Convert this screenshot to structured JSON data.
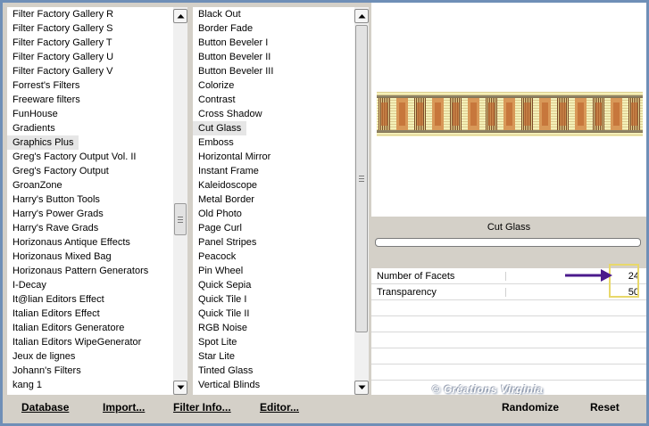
{
  "categories": {
    "items": [
      "Filter Factory Gallery R",
      "Filter Factory Gallery S",
      "Filter Factory Gallery T",
      "Filter Factory Gallery U",
      "Filter Factory Gallery V",
      "Forrest's Filters",
      "Freeware filters",
      "FunHouse",
      "Gradients",
      "Graphics Plus",
      "Greg's Factory Output Vol. II",
      "Greg's Factory Output",
      "GroanZone",
      "Harry's Button Tools",
      "Harry's Power Grads",
      "Harry's Rave Grads",
      "Horizonaus Antique Effects",
      "Horizonaus Mixed Bag",
      "Horizonaus Pattern Generators",
      "I-Decay",
      "It@lian Editors Effect",
      "Italian Editors Effect",
      "Italian Editors Generatore",
      "Italian Editors WipeGenerator",
      "Jeux de lignes",
      "Johann's Filters",
      "kang 1"
    ],
    "selected_index": 9
  },
  "filters": {
    "items": [
      "Black Out",
      "Border Fade",
      "Button Beveler I",
      "Button Beveler II",
      "Button Beveler III",
      "Colorize",
      "Contrast",
      "Cross Shadow",
      "Cut Glass",
      "Emboss",
      "Horizontal Mirror",
      "Instant Frame",
      "Kaleidoscope",
      "Metal Border",
      "Old Photo",
      "Page Curl",
      "Panel Stripes",
      "Peacock",
      "Pin Wheel",
      "Quick Sepia",
      "Quick Tile I",
      "Quick Tile II",
      "RGB Noise",
      "Spot Lite",
      "Star Lite",
      "Tinted Glass",
      "Vertical Blinds"
    ],
    "selected_index": 8
  },
  "filter_panel": {
    "title": "Cut Glass",
    "params": [
      {
        "name": "Number of Facets",
        "value": "24"
      },
      {
        "name": "Transparency",
        "value": "50"
      }
    ]
  },
  "buttons": {
    "database": "Database",
    "import": "Import...",
    "filter_info": "Filter Info...",
    "editor": "Editor...",
    "randomize": "Randomize",
    "reset": "Reset"
  },
  "watermark": "© Créations Virginia",
  "colors": {
    "window_border": "#6f8fb7",
    "panel_gray": "#d4d0c8",
    "highlight_box": "#e8d86a",
    "arrow": "#4b1a8c"
  }
}
